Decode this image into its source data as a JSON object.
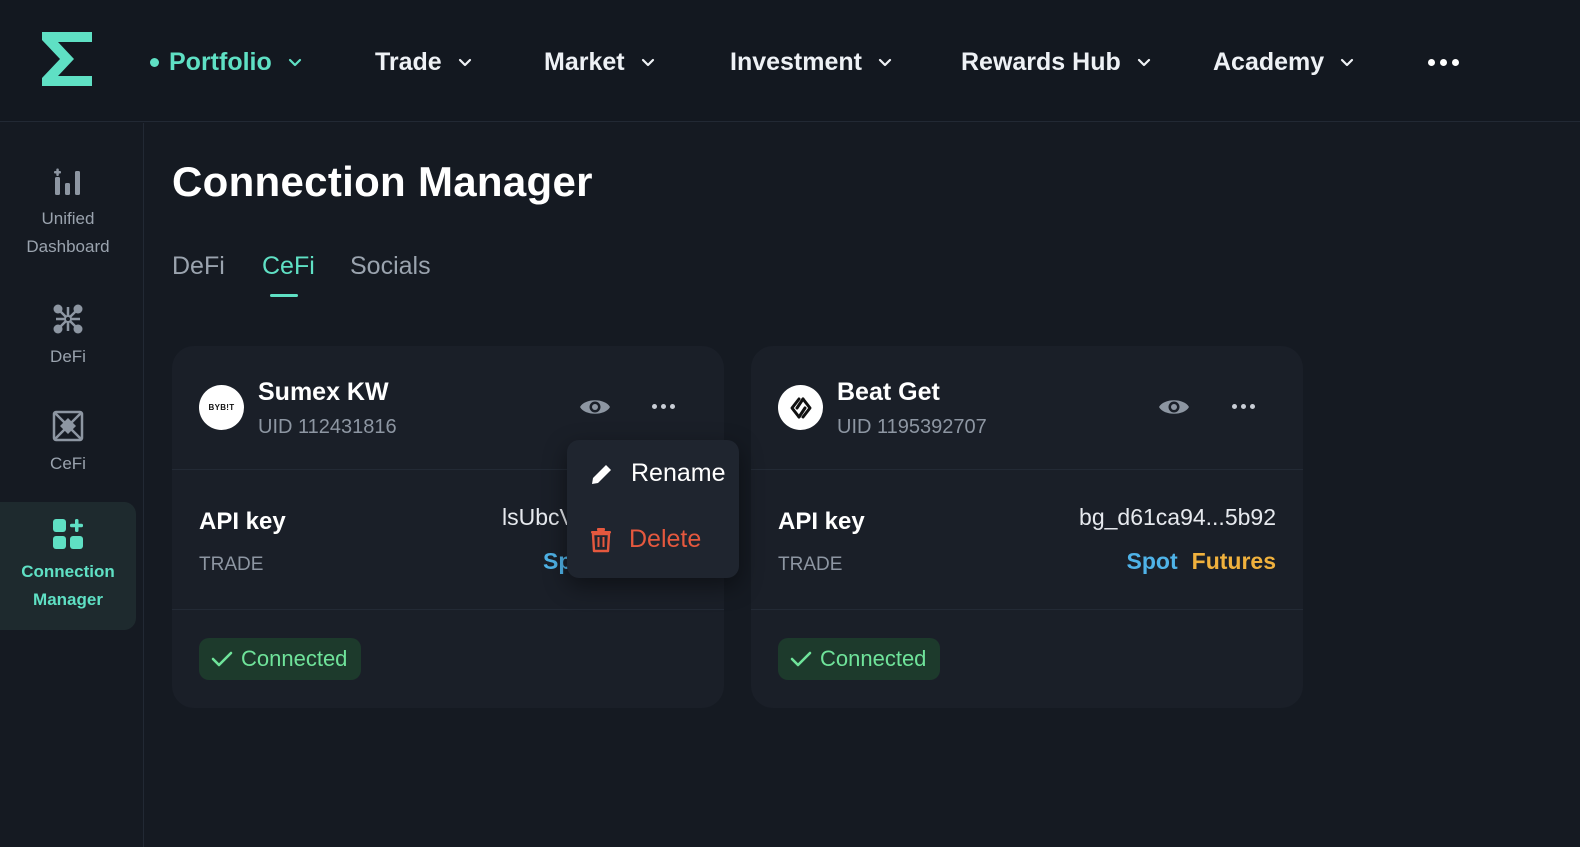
{
  "nav": {
    "items": [
      {
        "label": "Portfolio",
        "active": true
      },
      {
        "label": "Trade"
      },
      {
        "label": "Market"
      },
      {
        "label": "Investment"
      },
      {
        "label": "Rewards Hub"
      },
      {
        "label": "Academy"
      }
    ],
    "more_icon": "more-horizontal-icon"
  },
  "sidebar": {
    "items": [
      {
        "line1": "Unified",
        "line2": "Dashboard",
        "icon": "chart-bars-icon"
      },
      {
        "line1": "DeFi",
        "line2": "",
        "icon": "network-nodes-icon"
      },
      {
        "line1": "CeFi",
        "line2": "",
        "icon": "exchange-box-icon"
      },
      {
        "line1": "Connection",
        "line2": "Manager",
        "icon": "grid-plus-icon",
        "active": true
      }
    ]
  },
  "page": {
    "title": "Connection Manager",
    "tabs": [
      {
        "label": "DeFi"
      },
      {
        "label": "CeFi",
        "active": true
      },
      {
        "label": "Socials"
      }
    ]
  },
  "cards": [
    {
      "name": "Sumex KW",
      "uid": "UID 112431816",
      "logo_text": "BYB!T",
      "api_label": "API key",
      "api_type": "TRADE",
      "api_value": "lsUbcV",
      "tags": [
        "Sp"
      ],
      "status": "Connected"
    },
    {
      "name": "Beat Get",
      "uid": "UID 1195392707",
      "logo_text": "",
      "api_label": "API key",
      "api_type": "TRADE",
      "api_value": "bg_d61ca94...5b92",
      "tags": [
        "Spot",
        "Futures"
      ],
      "status": "Connected"
    }
  ],
  "context_menu": {
    "rename": "Rename",
    "delete": "Delete"
  },
  "colors": {
    "accent": "#5fe0c4",
    "background": "#151a22",
    "card": "#1a1f28",
    "spot": "#4fb3e8",
    "futures": "#f0b13d",
    "connected_text": "#6fe39a",
    "connected_bg": "#1d3a2c",
    "delete": "#e5583e"
  }
}
